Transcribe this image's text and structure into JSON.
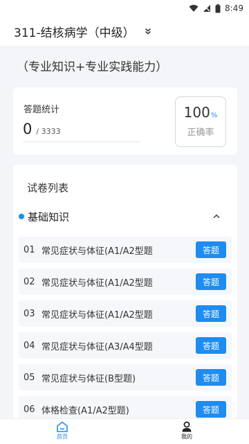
{
  "status_bar": {
    "time": "8:49"
  },
  "header": {
    "title": "311-结核病学（中级）"
  },
  "subtitle": "（专业知识+专业实践能力）",
  "stats": {
    "label": "答题统计",
    "answered": "0",
    "total": "/ 3333",
    "rate_value": "100",
    "rate_unit": "%",
    "rate_label": "正确率"
  },
  "paper_list": {
    "title": "试卷列表",
    "section": "基础知识",
    "button_label": "答题",
    "items": [
      {
        "no": "01",
        "name": "常见症状与体征(A1/A2型题"
      },
      {
        "no": "02",
        "name": "常见症状与体征(A1/A2型题"
      },
      {
        "no": "03",
        "name": "常见症状与体征(A1/A2型题"
      },
      {
        "no": "04",
        "name": "常见症状与体征(A3/A4型题"
      },
      {
        "no": "05",
        "name": "常见症状与体征(B型题)"
      },
      {
        "no": "06",
        "name": "体格检查(A1/A2型题)"
      }
    ]
  },
  "bottom_nav": {
    "home": "首页",
    "mine": "我的"
  },
  "colors": {
    "accent": "#1e8cf0",
    "background": "#f4f5f9"
  },
  "icons": [
    "wifi-icon",
    "signal-icon",
    "battery-icon",
    "chevron-double-down-icon",
    "caret-up-icon",
    "home-icon",
    "user-icon"
  ]
}
